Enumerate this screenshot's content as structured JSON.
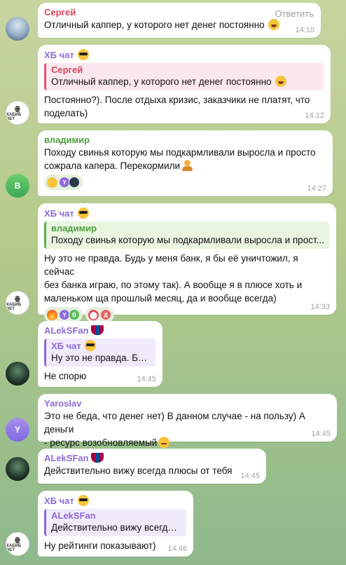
{
  "messages": [
    {
      "sender": "Сергей",
      "reply_label": "Ответить",
      "text": "Отличный каппер, у которого нет денег постоянно",
      "emoji": "laugh-emoji",
      "time": "14:10",
      "avatar": {
        "type": "photo",
        "initials": ""
      }
    },
    {
      "sender": "ХБ чат",
      "sender_emoji": "sunglasses-emoji",
      "quote": {
        "name": "Сергей",
        "text": "Отличный каппер, у которого нет денег постоянно"
      },
      "text": "Постоянно?). После отдыха кризис, заказчики не платят, что\nподелать)",
      "time": "14:12",
      "avatar": {
        "type": "logo",
        "initials": "ХАБИБ BET"
      }
    },
    {
      "sender": "владимир",
      "text": "Походу свинья которую мы подкармливали выросла и просто\nсожрала капера. Перекормили",
      "emoji": "person-emoji",
      "reactions": [
        {
          "emoji": "laugh-emoji",
          "users": [
            "Y",
            "dark"
          ]
        }
      ],
      "time": "14:27",
      "avatar": {
        "type": "letter",
        "initials": "В"
      }
    },
    {
      "sender": "ХБ чат",
      "sender_emoji": "sunglasses-emoji",
      "quote": {
        "name": "владимир",
        "text": "Походу свинья которую мы подкармливали выросла и прост..."
      },
      "text": "Ну это не правда. Будь у меня банк, я бы её уничтожил, я сейчас\nбез банка играю, по этому так). А вообще я в плюсе хоть и\nмаленьком ща прошлый месяц, да и вообще всегда)",
      "reactions": [
        {
          "emoji": "fire-emoji",
          "users": [
            "Y",
            "B"
          ]
        },
        {
          "emoji": "clown-emoji",
          "users": [
            "Д"
          ]
        }
      ],
      "time": "14:33",
      "avatar": {
        "type": "logo",
        "initials": "ХАБИБ BET"
      }
    },
    {
      "sender": "ALekSFan",
      "sender_emoji": "barcelona-flag",
      "quote": {
        "name": "ХБ чат",
        "text": "Ну это не правда. Буд..."
      },
      "text": "Не спорю",
      "time": "14:45",
      "avatar": {
        "type": "dark",
        "initials": ""
      }
    },
    {
      "sender": "Yaroslav",
      "text": "Это не беда, что денег нет) В данном случае - на пользу) А деньги\n- ресурс возобновляемый",
      "emoji": "wink-emoji",
      "time": "14:45",
      "avatar": {
        "type": "letter",
        "initials": "Y"
      }
    },
    {
      "sender": "ALekSFan",
      "sender_emoji": "barcelona-flag",
      "text": "Действительно вижу всегда плюсы от тебя",
      "time": "14:45",
      "avatar": {
        "type": "dark",
        "initials": ""
      }
    },
    {
      "sender": "ХБ чат",
      "sender_emoji": "sunglasses-emoji",
      "quote": {
        "name": "ALekSFan",
        "text": "Действительно вижу всегда ..."
      },
      "text": "Ну рейтинги показывают)",
      "time": "14:46",
      "avatar": {
        "type": "logo",
        "initials": "ХАБИБ BET"
      }
    }
  ],
  "colors": {
    "sergey": "#d8435f",
    "hb_chat": "#8e6bd8",
    "vladimir": "#4a9e3c",
    "time": "#a0a7a0"
  }
}
